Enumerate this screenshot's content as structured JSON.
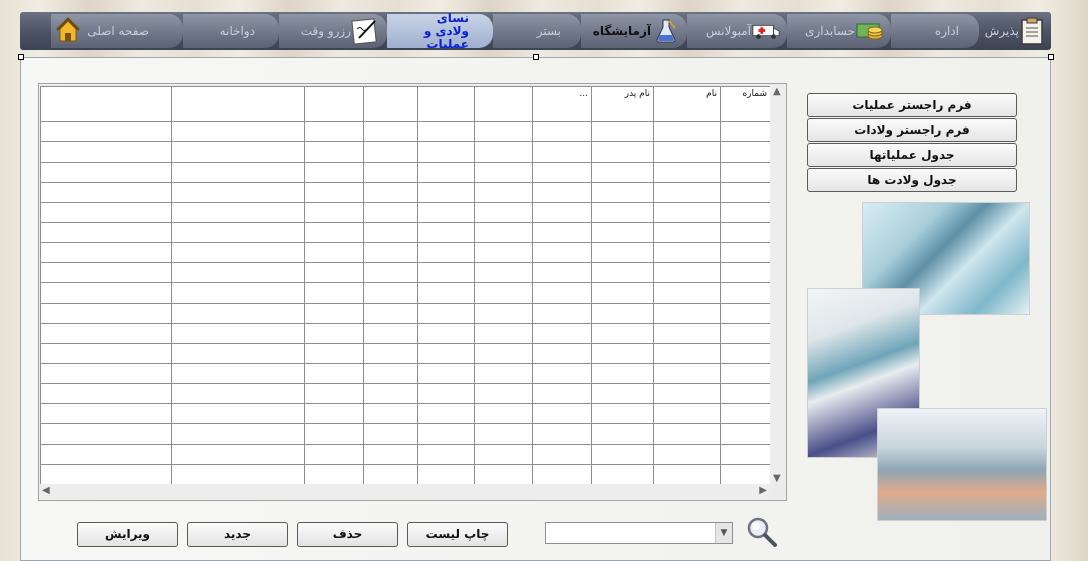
{
  "tabs": [
    {
      "label": "پذیرش",
      "icon": "clipboard-icon"
    },
    {
      "label": "اداره",
      "icon": ""
    },
    {
      "label": "حسابداری",
      "icon": "coins-icon"
    },
    {
      "label": "آمبولانس",
      "icon": "ambulance-icon"
    },
    {
      "label": "آزمایشگاه",
      "icon": "flask-icon"
    },
    {
      "label": "بستر",
      "icon": ""
    },
    {
      "label": "نسای ولادی و عملیات",
      "icon": ""
    },
    {
      "label": "رزرو وقت",
      "icon": "note-icon"
    },
    {
      "label": "دواخانه",
      "icon": ""
    },
    {
      "label": "صفحه اصلی",
      "icon": "home-icon"
    }
  ],
  "grid": {
    "headers": [
      "شماره",
      "نام",
      "نام پدر",
      "...",
      "",
      "",
      "",
      "",
      "",
      ""
    ],
    "row_count": 18
  },
  "side_buttons": [
    "فرم راجستر عملیات",
    "فرم راجستر ولادات",
    "جدول عملیاتها",
    "جدول ولادت ها"
  ],
  "actions": {
    "print": "چاپ لیست",
    "delete": "حذف",
    "new": "جدید",
    "edit": "ویرایش"
  },
  "search": {
    "value": ""
  }
}
